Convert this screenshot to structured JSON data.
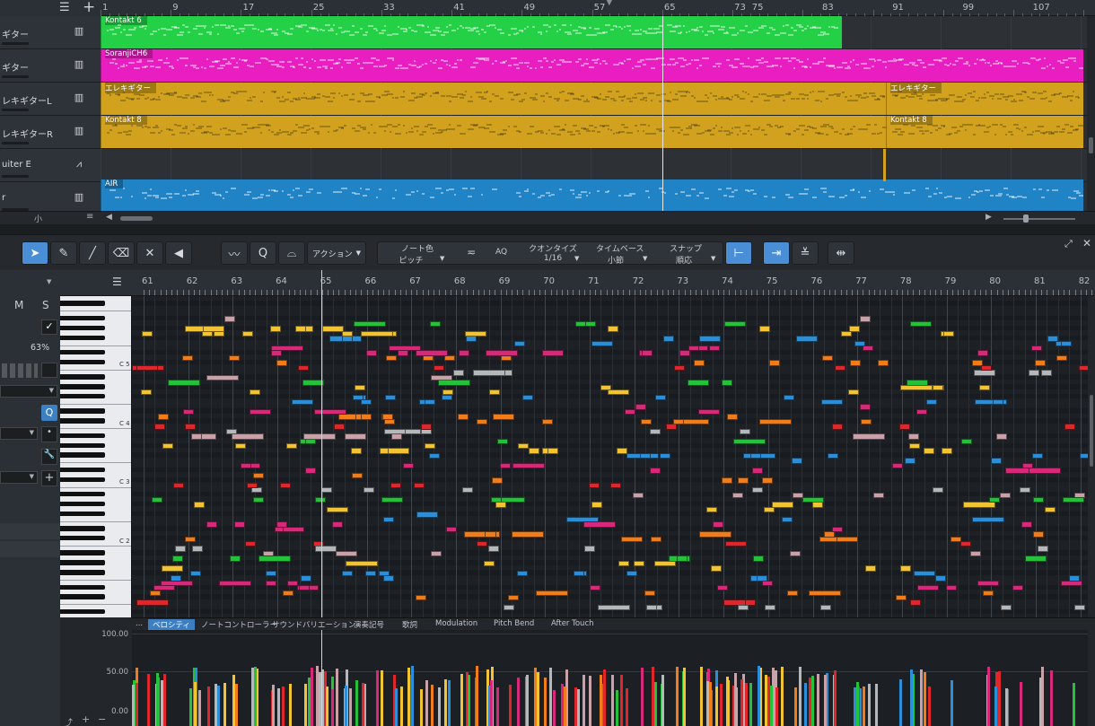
{
  "arrange": {
    "ruler_numbers": [
      "1",
      "9",
      "17",
      "25",
      "33",
      "41",
      "49",
      "57",
      "65",
      "73",
      "75",
      "83",
      "91",
      "99",
      "107"
    ],
    "tracks": [
      {
        "name": "ギター",
        "icon": "piano-icon"
      },
      {
        "name": "ギター",
        "icon": "piano-icon"
      },
      {
        "name": "レキギターL",
        "icon": "piano-icon"
      },
      {
        "name": "レキギターR",
        "icon": "piano-icon"
      },
      {
        "name": "uiter E",
        "icon": "audio-wave-icon"
      },
      {
        "name": "r",
        "icon": "piano-icon"
      }
    ],
    "clips": [
      {
        "lane": 0,
        "label": "Kontakt 6",
        "color": "#23d046"
      },
      {
        "lane": 1,
        "label": "SoranjiCH6",
        "color": "#e81ec0"
      },
      {
        "lane": 2,
        "label": "エレキギター",
        "color": "#d2a21e"
      },
      {
        "lane": 2,
        "label": "エレキギター",
        "color": "#d2a21e"
      },
      {
        "lane": 3,
        "label": "Kontakt 8",
        "color": "#d2a21e"
      },
      {
        "lane": 3,
        "label": "Kontakt 8",
        "color": "#d2a21e"
      },
      {
        "lane": 5,
        "label": "AIR",
        "color": "#1f83c6"
      }
    ],
    "bottom_label": "小"
  },
  "toolbar": {
    "action_label": "アクション",
    "note_color_label": "ノート色",
    "note_color_value": "ピッチ",
    "aq_label": "AQ",
    "quantize_label": "クオンタイズ",
    "quantize_value": "1/16",
    "timebase_label": "タイムベース",
    "timebase_value": "小節",
    "snap_label": "スナップ",
    "snap_value": "順応"
  },
  "inspector": {
    "mute": "M",
    "solo": "S",
    "zoom": "63%"
  },
  "piano_roll": {
    "ruler_numbers": [
      "61",
      "62",
      "63",
      "64",
      "65",
      "66",
      "67",
      "68",
      "69",
      "70",
      "71",
      "72",
      "73",
      "74",
      "75",
      "76",
      "77",
      "78",
      "79",
      "80",
      "81",
      "82"
    ],
    "octave_labels": [
      "C 5",
      "C 4",
      "C 3",
      "C 2"
    ]
  },
  "tabs": [
    "...",
    "ベロシティ",
    "ノートコントローラー",
    "サウンドバリエーション",
    "演奏記号",
    "歌詞",
    "Modulation",
    "Pitch Bend",
    "After Touch"
  ],
  "velocity_labels": [
    "100.00",
    "50.00",
    "0.00"
  ],
  "colors": {
    "accent": "#4a8fd6",
    "red": "#e0262b",
    "orange": "#f07d19",
    "magenta": "#d8287a",
    "blue": "#2a8fd8",
    "yellow": "#f2c332",
    "green": "#26c13a",
    "pink": "#c9a1a8",
    "grey": "#b5b8bb"
  }
}
